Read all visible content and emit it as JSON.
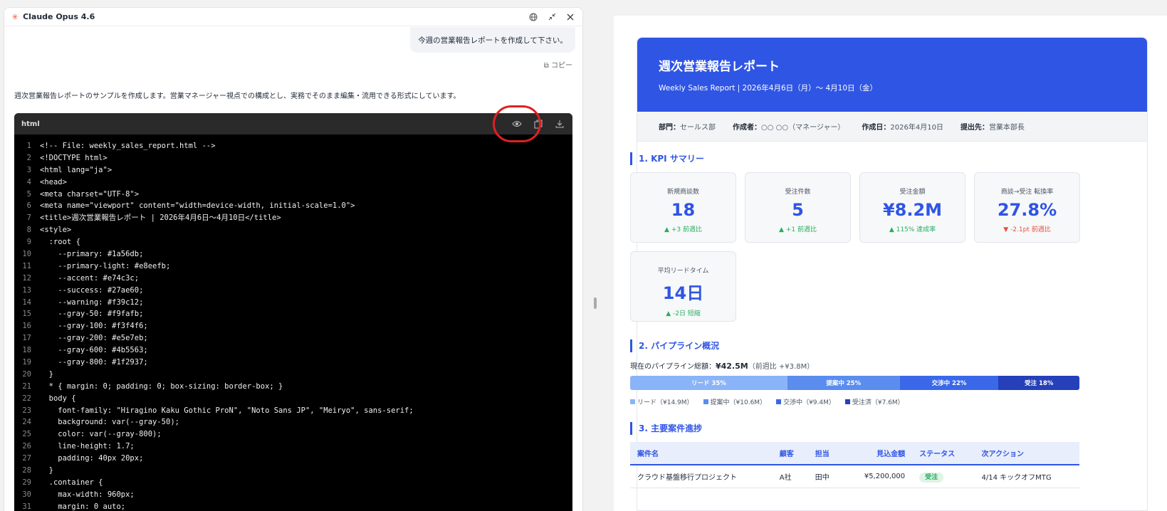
{
  "panel": {
    "title": "Claude Opus 4.6"
  },
  "chat": {
    "user_message": "今週の営業報告レポートを作成して下さい。",
    "copy_label": "コピー",
    "assistant_intro": "週次営業報告レポートのサンプルを作成します。営業マネージャー視点での構成とし、実務でそのまま編集・流用できる形式にしています。"
  },
  "code": {
    "language": "html",
    "lines": [
      "<!-- File: weekly_sales_report.html -->",
      "<!DOCTYPE html>",
      "<html lang=\"ja\">",
      "<head>",
      "<meta charset=\"UTF-8\">",
      "<meta name=\"viewport\" content=\"width=device-width, initial-scale=1.0\">",
      "<title>週次営業報告レポート | 2026年4月6日〜4月10日</title>",
      "<style>",
      "  :root {",
      "    --primary: #1a56db;",
      "    --primary-light: #e8eefb;",
      "    --accent: #e74c3c;",
      "    --success: #27ae60;",
      "    --warning: #f39c12;",
      "    --gray-50: #f9fafb;",
      "    --gray-100: #f3f4f6;",
      "    --gray-200: #e5e7eb;",
      "    --gray-600: #4b5563;",
      "    --gray-800: #1f2937;",
      "  }",
      "  * { margin: 0; padding: 0; box-sizing: border-box; }",
      "  body {",
      "    font-family: \"Hiragino Kaku Gothic ProN\", \"Noto Sans JP\", \"Meiryo\", sans-serif;",
      "    background: var(--gray-50);",
      "    color: var(--gray-800);",
      "    line-height: 1.7;",
      "    padding: 40px 20px;",
      "  }",
      "  .container {",
      "    max-width: 960px;",
      "    margin: 0 auto;"
    ]
  },
  "report": {
    "title": "週次営業報告レポート",
    "subtitle": "Weekly Sales Report | 2026年4月6日（月）〜 4月10日（金）",
    "meta": {
      "dept_label": "部門：",
      "dept": "セールス部",
      "author_label": "作成者：",
      "author": "○○ ○○（マネージャー）",
      "date_label": "作成日：",
      "date": "2026年4月10日",
      "to_label": "提出先：",
      "to": "営業本部長"
    },
    "sec1": "1. KPI サマリー",
    "kpis": [
      {
        "label": "新規商談数",
        "value": "18",
        "change": "▲ +3 前週比",
        "dir": "up"
      },
      {
        "label": "受注件数",
        "value": "5",
        "change": "▲ +1 前週比",
        "dir": "up"
      },
      {
        "label": "受注金額",
        "value": "¥8.2M",
        "change": "▲ 115% 達成率",
        "dir": "up"
      },
      {
        "label": "商談→受注 転換率",
        "value": "27.8%",
        "change": "▼ -2.1pt 前週比",
        "dir": "dn"
      },
      {
        "label": "平均リードタイム",
        "value": "14日",
        "change": "▲ -2日 短縮",
        "dir": "up"
      }
    ],
    "sec2": "2. パイプライン概況",
    "pipeline_total_label": "現在のパイプライン総額：",
    "pipeline_total": "¥42.5M",
    "pipeline_change": "（前週比 +¥3.8M）",
    "pipeline": [
      {
        "label": "リード 35%",
        "share": 35,
        "color": "#8ab4f8"
      },
      {
        "label": "提案中 25%",
        "share": 25,
        "color": "#5b8def"
      },
      {
        "label": "交渉中 22%",
        "share": 22,
        "color": "#3a68e8"
      },
      {
        "label": "受注 18%",
        "share": 18,
        "color": "#2540b8"
      }
    ],
    "legend": [
      "リード（¥14.9M）",
      "提案中（¥10.6M）",
      "交渉中（¥9.4M）",
      "受注済（¥7.6M）"
    ],
    "sec3": "3. 主要案件進捗",
    "table": {
      "headers": [
        "案件名",
        "顧客",
        "担当",
        "見込金額",
        "ステータス",
        "次アクション"
      ],
      "rows": [
        [
          "クラウド基盤移行プロジェクト",
          "A社",
          "田中",
          "¥5,200,000",
          "受注",
          "4/14 キックオフMTG"
        ]
      ]
    }
  }
}
